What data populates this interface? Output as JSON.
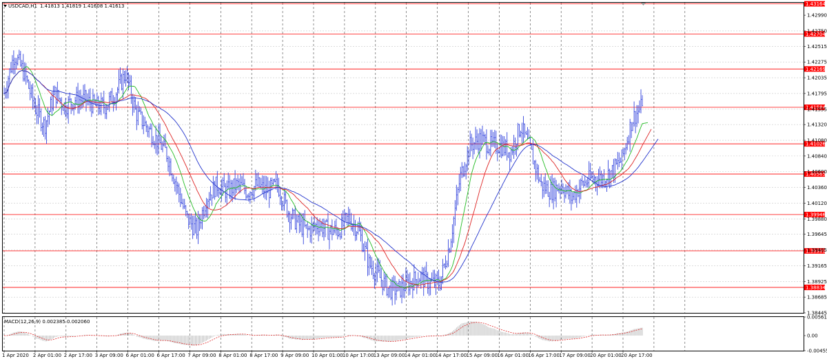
{
  "header": {
    "symbol": "USDCAD,H1",
    "ohlc": "1.41813 1.41819 1.41608 1.41613",
    "macd_label": "MACD(12,26,9) 0.002385 0.002060"
  },
  "colors": {
    "candle": "#3344dd",
    "ma_fast": "#22bb22",
    "ma_mid": "#dd2222",
    "ma_slow": "#2233cc",
    "level": "#ff0000",
    "grid": "#c8c8c8",
    "vgrid": "#444444",
    "macd_hist": "#b0b0b0",
    "macd_signal": "#dd2222",
    "price_tag": "#ff0000"
  },
  "icons": {
    "dropdown": "triangle-down-icon",
    "scroll_marker": "triangle-down-icon"
  },
  "chart_data": [
    {
      "type": "candlestick",
      "symbol": "USDCAD",
      "timeframe": "H1",
      "ylim": [
        1.38445,
        1.4318
      ],
      "price_ticks": [
        "1.42990",
        "1.42750",
        "1.42515",
        "1.42275",
        "1.42035",
        "1.41795",
        "1.41555",
        "1.41320",
        "1.41080",
        "1.40840",
        "1.40600",
        "1.40360",
        "1.40120",
        "1.39880",
        "1.39645",
        "1.39405",
        "1.39165",
        "1.38925",
        "1.38685",
        "1.38445"
      ],
      "levels": [
        "1.43164",
        "1.42704",
        "1.42169",
        "1.41584",
        "1.41026",
        "1.40565",
        "1.39946",
        "1.39391",
        "1.38834"
      ],
      "time_ticks": [
        "1 Apr 2020",
        "2 Apr 01:00",
        "2 Apr 17:00",
        "3 Apr 09:00",
        "6 Apr 01:00",
        "6 Apr 17:00",
        "7 Apr 09:00",
        "8 Apr 01:00",
        "8 Apr 17:00",
        "9 Apr 09:00",
        "10 Apr 01:00",
        "10 Apr 17:00",
        "13 Apr 09:00",
        "14 Apr 01:00",
        "14 Apr 17:00",
        "15 Apr 09:00",
        "16 Apr 01:00",
        "16 Apr 17:00",
        "17 Apr 09:00",
        "20 Apr 01:00",
        "20 Apr 17:00"
      ],
      "close_path": [
        1.418,
        1.424,
        1.421,
        1.416,
        1.413,
        1.418,
        1.416,
        1.417,
        1.417,
        1.416,
        1.416,
        1.418,
        1.421,
        1.415,
        1.413,
        1.411,
        1.409,
        1.404,
        1.399,
        1.397,
        1.402,
        1.404,
        1.403,
        1.404,
        1.403,
        1.404,
        1.403,
        1.404,
        1.4,
        1.398,
        1.397,
        1.398,
        1.397,
        1.397,
        1.399,
        1.397,
        1.392,
        1.39,
        1.388,
        1.388,
        1.389,
        1.39,
        1.389,
        1.389,
        1.395,
        1.405,
        1.41,
        1.411,
        1.41,
        1.41,
        1.409,
        1.413,
        1.409,
        1.404,
        1.403,
        1.404,
        1.402,
        1.404,
        1.405,
        1.405,
        1.406,
        1.408,
        1.414,
        1.4161
      ]
    },
    {
      "type": "bar",
      "name": "MACD(12,26,9)",
      "ylim": [
        -0.004556,
        0.005619
      ],
      "ticks": [
        "0.005619",
        "0.00",
        "-0.004556"
      ],
      "macd": 0.002385,
      "signal": 0.00206
    }
  ]
}
